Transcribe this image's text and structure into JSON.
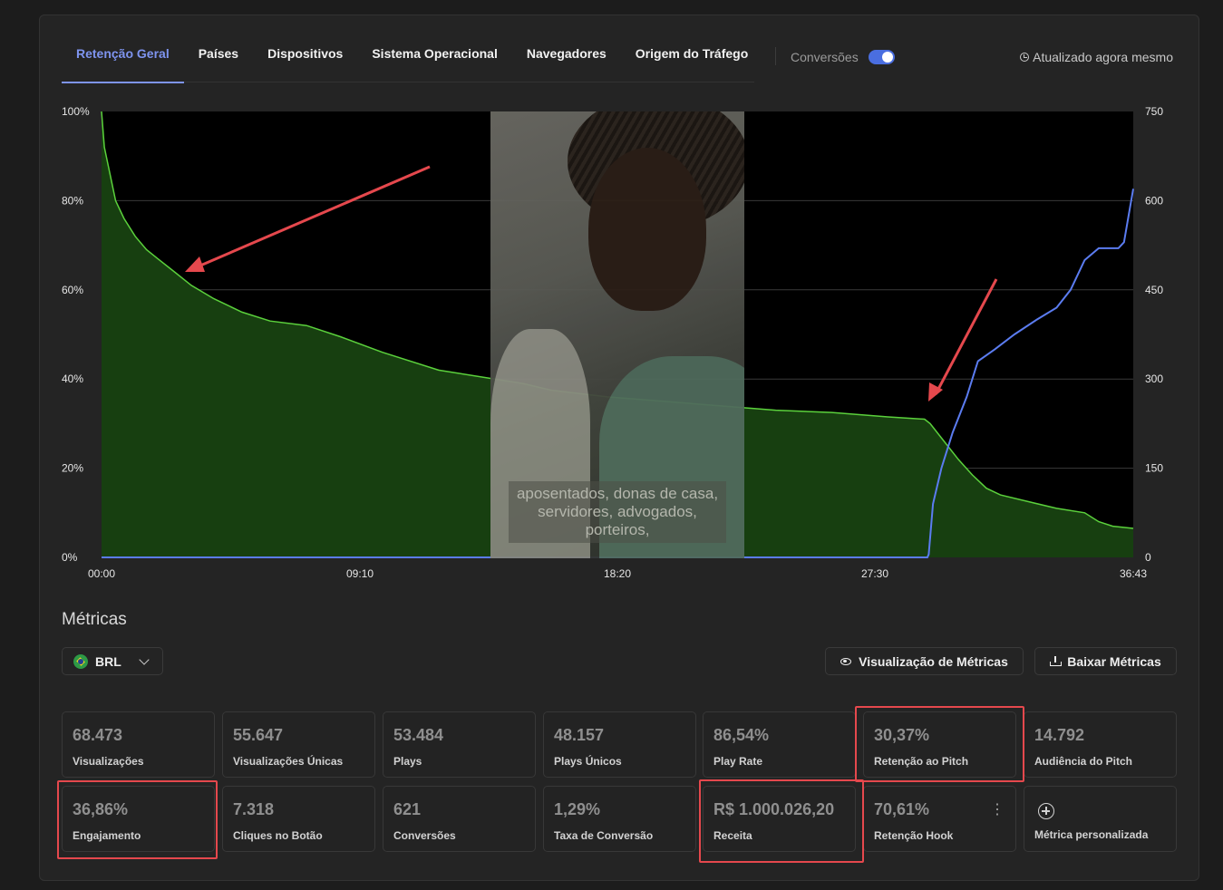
{
  "tabs": [
    {
      "label": "Retenção Geral"
    },
    {
      "label": "Países"
    },
    {
      "label": "Dispositivos"
    },
    {
      "label": "Sistema Operacional"
    },
    {
      "label": "Navegadores"
    },
    {
      "label": "Origem do Tráfego"
    }
  ],
  "conversions_label": "Conversões",
  "conversions_on": true,
  "updated_text": "Atualizado agora mesmo",
  "colors": {
    "accent": "#7e94ef",
    "retention_line": "#5bd13c",
    "conversion_line": "#5b7cf0",
    "highlight": "#e5484d"
  },
  "video_caption": "aposentados, donas de casa, servidores, advogados, porteiros,",
  "chart_data": {
    "type": "area",
    "x_ticks": [
      "00:00",
      "09:10",
      "18:20",
      "27:30",
      "36:43"
    ],
    "y_left_ticks": [
      "0%",
      "20%",
      "40%",
      "60%",
      "80%",
      "100%"
    ],
    "y_right_ticks": [
      "0",
      "150",
      "300",
      "450",
      "600",
      "750"
    ],
    "grid": true,
    "series": [
      {
        "axis": "left",
        "x": [
          0,
          0.1,
          0.3,
          0.5,
          0.8,
          1.2,
          1.6,
          2.0,
          2.6,
          3.2,
          4,
          5,
          6,
          7.3,
          8.5,
          10,
          12,
          14,
          15,
          16,
          18,
          20,
          22,
          24,
          26,
          28,
          29.3,
          29.5,
          30,
          30.5,
          31,
          31.5,
          32,
          33,
          34,
          35,
          35.5,
          36,
          36.73
        ],
        "values": [
          100,
          92,
          86,
          80,
          76,
          72,
          69,
          67,
          64,
          61,
          58,
          55,
          53,
          52,
          49.5,
          46,
          42,
          40,
          39,
          37.5,
          36,
          35,
          34,
          33,
          32.5,
          31.5,
          31,
          30,
          26,
          22,
          18.5,
          15.5,
          14,
          12.5,
          11,
          10,
          8,
          7,
          6.5
        ]
      },
      {
        "axis": "right",
        "x": [
          0,
          29.4,
          29.45,
          29.6,
          29.9,
          30.3,
          30.8,
          31.2,
          31.8,
          32.5,
          33.3,
          34,
          34.5,
          35,
          35.5,
          36.2,
          36.4,
          36.73
        ],
        "values": [
          0,
          0,
          5,
          90,
          150,
          210,
          270,
          330,
          350,
          375,
          400,
          420,
          450,
          500,
          520,
          520,
          530,
          620
        ]
      }
    ]
  },
  "metrics_title": "Métricas",
  "currency": "BRL",
  "btn_view": "Visualização de Métricas",
  "btn_download": "Baixar Métricas",
  "cards": [
    {
      "value": "68.473",
      "label": "Visualizações"
    },
    {
      "value": "55.647",
      "label": "Visualizações Únicas"
    },
    {
      "value": "53.484",
      "label": "Plays"
    },
    {
      "value": "48.157",
      "label": "Plays Únicos"
    },
    {
      "value": "86,54%",
      "label": "Play Rate"
    },
    {
      "value": "30,37%",
      "label": "Retenção ao Pitch"
    },
    {
      "value": "14.792",
      "label": "Audiência do Pitch"
    },
    {
      "value": "36,86%",
      "label": "Engajamento"
    },
    {
      "value": "7.318",
      "label": "Cliques no Botão"
    },
    {
      "value": "621",
      "label": "Conversões"
    },
    {
      "value": "1,29%",
      "label": "Taxa de Conversão"
    },
    {
      "value": "R$ 1.000.026,20",
      "label": "Receita"
    },
    {
      "value": "70,61%",
      "label": "Retenção Hook"
    }
  ],
  "custom_metric_label": "Métrica personalizada"
}
